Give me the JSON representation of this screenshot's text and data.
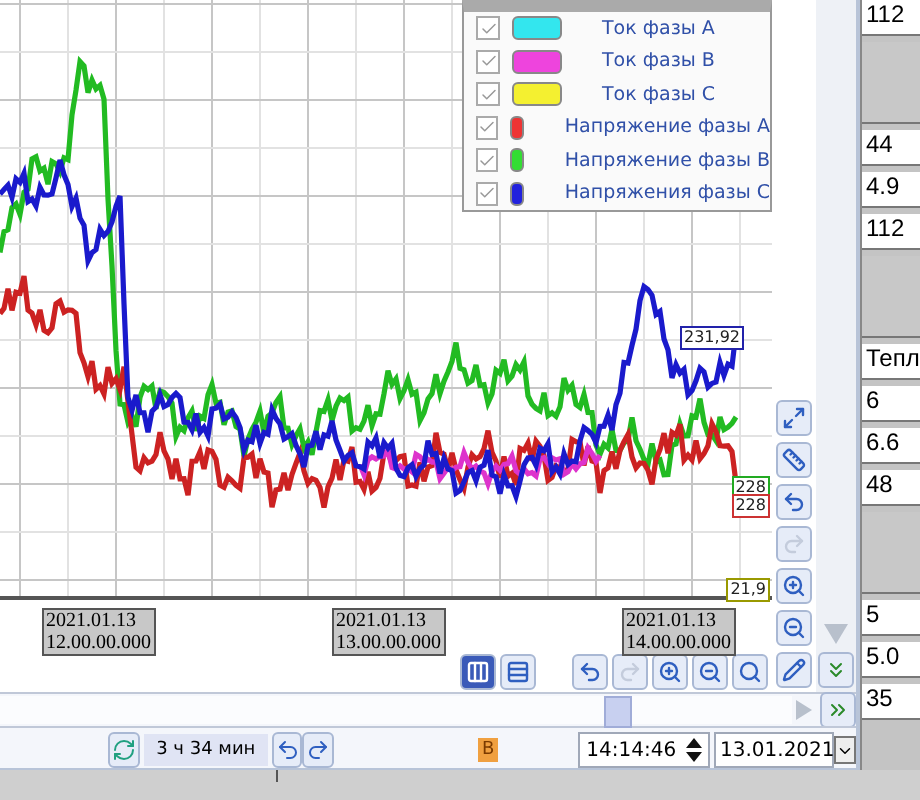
{
  "legend": {
    "items": [
      {
        "checked": true,
        "color": "#33e6ee",
        "label": "Ток фазы A"
      },
      {
        "checked": true,
        "color": "#ee44dd",
        "label": "Ток фазы B"
      },
      {
        "checked": true,
        "color": "#f4f030",
        "label": "Ток фазы C"
      },
      {
        "checked": true,
        "color": "#ee3333",
        "label": "Напряжение фазы A"
      },
      {
        "checked": true,
        "color": "#33dd33",
        "label": "Напряжение фазы B"
      },
      {
        "checked": true,
        "color": "#2222dd",
        "label": "Напряжения фазы C"
      }
    ]
  },
  "value_tags": [
    {
      "text": "231,92",
      "color": "#2222aa"
    },
    {
      "text": "228",
      "color": "#22aa22"
    },
    {
      "text": "228",
      "color": "#cc3333"
    },
    {
      "text": "21,9",
      "color": "#999900"
    }
  ],
  "time_labels": [
    {
      "date": "2021.01.13",
      "time": "12.00.00.000"
    },
    {
      "date": "2021.01.13",
      "time": "13.00.00.000"
    },
    {
      "date": "2021.01.13",
      "time": "14.00.00.000"
    }
  ],
  "side_tools": [
    {
      "kind": "fit",
      "disabled": false
    },
    {
      "kind": "ruler",
      "disabled": false
    },
    {
      "kind": "undo",
      "disabled": false
    },
    {
      "kind": "redo",
      "disabled": true
    },
    {
      "kind": "zoom_in",
      "disabled": false
    },
    {
      "kind": "zoom_out",
      "disabled": false
    },
    {
      "kind": "edit",
      "disabled": false
    }
  ],
  "view_modes": [
    {
      "kind": "columns",
      "selected": true
    },
    {
      "kind": "rows",
      "selected": false
    }
  ],
  "bottom_tools": [
    {
      "kind": "undo",
      "disabled": false
    },
    {
      "kind": "redo",
      "disabled": true
    },
    {
      "kind": "zoom_in",
      "disabled": false
    },
    {
      "kind": "zoom_out",
      "disabled": false
    },
    {
      "kind": "search",
      "disabled": false
    }
  ],
  "status": {
    "duration": "3 ч 34 мин",
    "badge": "B",
    "time": "14:14:46",
    "date": "13.01.2021"
  },
  "side_cells": [
    "112",
    "",
    "44",
    "4.9",
    "112",
    "",
    "Тепл",
    "6",
    "6.6",
    "48",
    "",
    "5",
    "5.0",
    "35"
  ]
}
